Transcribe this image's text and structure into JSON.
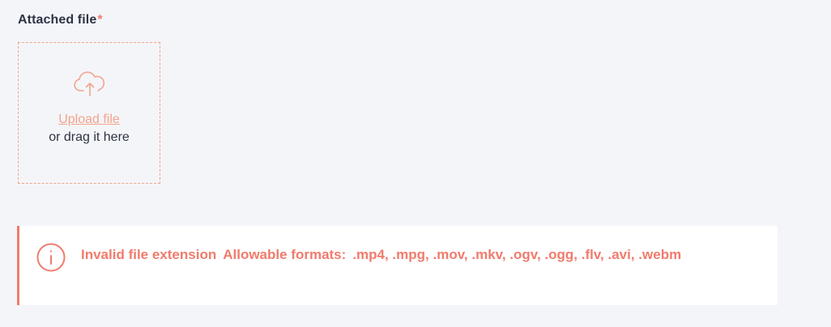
{
  "field": {
    "label": "Attached file",
    "required_mark": "*"
  },
  "dropzone": {
    "icon": "cloud-upload-icon",
    "upload_link": "Upload file",
    "drag_text": "or drag it here"
  },
  "alert": {
    "icon": "info-icon",
    "title": "Invalid file extension",
    "formats_label": "Allowable formats:",
    "formats": ".mp4, .mpg, .mov, .mkv, .ogv, .ogg, .flv, .avi, .webm"
  },
  "colors": {
    "background": "#f4f5f9",
    "accent": "#f2a48c",
    "error": "#f07b6c",
    "text": "#2e3443"
  }
}
